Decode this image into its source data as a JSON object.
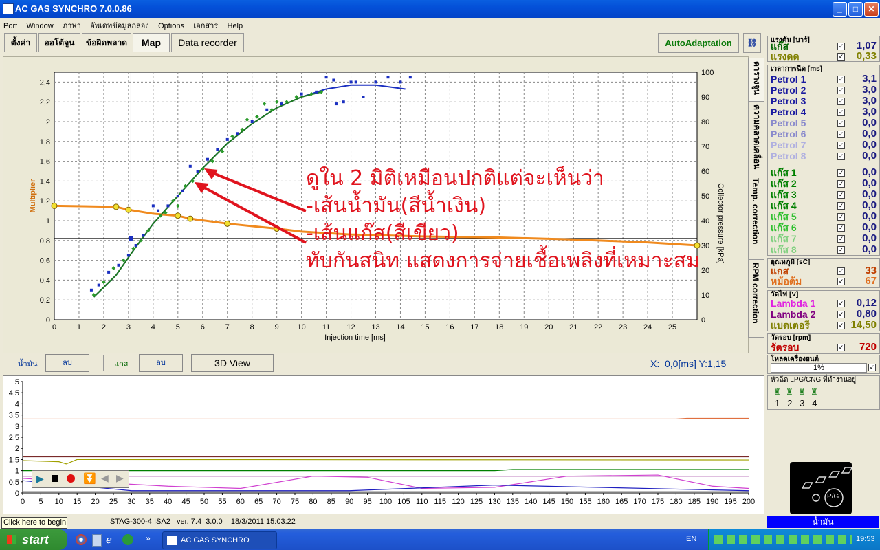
{
  "window": {
    "title": "AC GAS SYNCHRO  7.0.0.86"
  },
  "menu": [
    "Port",
    "Window",
    "ภาษา",
    "อัพเดทข้อมูลกล่อง",
    "Options",
    "เอกสาร",
    "Help"
  ],
  "tabs": [
    "ตั้งค่า",
    "ออโต้จูน",
    "ข้อผิดพลาด",
    "Map",
    "Data recorder"
  ],
  "autoadaptation": "AutoAdaptation",
  "vertical_tabs": [
    "ตารางจูน",
    "ความคลาดเคลื่อน",
    "Temp. correction",
    "RPM correction"
  ],
  "chart_data": {
    "type": "scatter",
    "xlabel": "Injection time [ms]",
    "ylabel": "Multiplier",
    "y2label": "Collector pressure [kPa]",
    "xlim": [
      0,
      26
    ],
    "ylim": [
      0,
      2.5
    ],
    "y2lim": [
      0,
      100
    ],
    "x_ticks": [
      0,
      1,
      2,
      3,
      4,
      5,
      6,
      7,
      8,
      9,
      10,
      11,
      12,
      13,
      14,
      15,
      16,
      17,
      18,
      19,
      20,
      21,
      22,
      23,
      24,
      25
    ],
    "y_ticks": [
      "0",
      "0,2",
      "0,4",
      "0,6",
      "0,8",
      "1",
      "1,2",
      "1,4",
      "1,6",
      "1,8",
      "2",
      "2,2",
      "2,4"
    ],
    "y2_ticks": [
      "0",
      "10",
      "20",
      "30",
      "40",
      "50",
      "60",
      "70",
      "80",
      "90",
      "100"
    ],
    "grid": true,
    "cursor": {
      "x": 3.1,
      "y": 0.82
    },
    "multiplier_line": {
      "name": "orange",
      "color": "#f08a1e",
      "points": [
        [
          0,
          1.15
        ],
        [
          2.5,
          1.14
        ],
        [
          3,
          1.11
        ],
        [
          4,
          1.07
        ],
        [
          5,
          1.05
        ],
        [
          5.5,
          1.02
        ],
        [
          7,
          0.97
        ],
        [
          9,
          0.92
        ],
        [
          10,
          0.89
        ],
        [
          12,
          0.86
        ],
        [
          15,
          0.84
        ],
        [
          18,
          0.83
        ],
        [
          21,
          0.81
        ],
        [
          24,
          0.78
        ],
        [
          26,
          0.75
        ]
      ],
      "markers": [
        [
          0,
          1.15
        ],
        [
          2.5,
          1.14
        ],
        [
          3,
          1.11
        ],
        [
          5,
          1.05
        ],
        [
          5.5,
          1.02
        ],
        [
          7,
          0.97
        ],
        [
          9,
          0.92
        ],
        [
          26,
          0.75
        ]
      ]
    },
    "petrol_curve": {
      "color": "#1a2fc0",
      "points": [
        [
          1.6,
          0.23
        ],
        [
          2.5,
          0.45
        ],
        [
          3.2,
          0.7
        ],
        [
          4,
          0.97
        ],
        [
          5,
          1.25
        ],
        [
          6,
          1.53
        ],
        [
          7,
          1.78
        ],
        [
          8,
          1.98
        ],
        [
          9,
          2.14
        ],
        [
          10,
          2.25
        ],
        [
          11,
          2.33
        ],
        [
          12,
          2.37
        ],
        [
          13,
          2.37
        ],
        [
          14.2,
          2.33
        ]
      ]
    },
    "gas_curve": {
      "color": "#1e7a1e",
      "points": [
        [
          1.6,
          0.23
        ],
        [
          2.5,
          0.45
        ],
        [
          3.2,
          0.7
        ],
        [
          4,
          0.97
        ],
        [
          5,
          1.25
        ],
        [
          6,
          1.53
        ],
        [
          7,
          1.78
        ],
        [
          8,
          1.98
        ],
        [
          9,
          2.14
        ],
        [
          10,
          2.25
        ],
        [
          10.8,
          2.3
        ]
      ]
    },
    "petrol_points": [
      [
        1.5,
        0.3
      ],
      [
        1.8,
        0.35
      ],
      [
        2.2,
        0.48
      ],
      [
        2.6,
        0.55
      ],
      [
        3,
        0.65
      ],
      [
        3.3,
        0.75
      ],
      [
        3.6,
        0.85
      ],
      [
        4,
        1.15
      ],
      [
        4.2,
        1.1
      ],
      [
        4.6,
        1.15
      ],
      [
        5,
        1.25
      ],
      [
        5.2,
        1.3
      ],
      [
        5.5,
        1.55
      ],
      [
        5.8,
        1.5
      ],
      [
        6.2,
        1.62
      ],
      [
        6.6,
        1.72
      ],
      [
        7,
        1.82
      ],
      [
        7.4,
        1.88
      ],
      [
        8,
        2.0
      ],
      [
        8.6,
        2.12
      ],
      [
        9.2,
        2.18
      ],
      [
        10,
        2.28
      ],
      [
        10.6,
        2.3
      ],
      [
        11,
        2.45
      ],
      [
        11.3,
        2.42
      ],
      [
        11.7,
        2.2
      ],
      [
        12,
        2.4
      ],
      [
        12.5,
        2.25
      ],
      [
        13,
        2.4
      ],
      [
        13.5,
        2.45
      ],
      [
        14,
        2.4
      ],
      [
        14.4,
        2.45
      ],
      [
        11.4,
        2.18
      ],
      [
        12.2,
        2.4
      ]
    ],
    "gas_points": [
      [
        1.6,
        0.25
      ],
      [
        2,
        0.38
      ],
      [
        2.4,
        0.52
      ],
      [
        2.8,
        0.6
      ],
      [
        3.2,
        0.72
      ],
      [
        3.5,
        0.8
      ],
      [
        3.8,
        0.9
      ],
      [
        4.3,
        1.05
      ],
      [
        4.8,
        1.2
      ],
      [
        5.3,
        1.35
      ],
      [
        5.6,
        1.4
      ],
      [
        6,
        1.52
      ],
      [
        6.4,
        1.6
      ],
      [
        6.8,
        1.7
      ],
      [
        7.2,
        1.85
      ],
      [
        7.6,
        1.92
      ],
      [
        8.2,
        2.05
      ],
      [
        8.8,
        2.12
      ],
      [
        9.4,
        2.2
      ],
      [
        9.8,
        2.25
      ],
      [
        10.4,
        2.28
      ],
      [
        10.8,
        2.3
      ],
      [
        7.8,
        2.02
      ],
      [
        8.5,
        2.18
      ],
      [
        9,
        2.2
      ],
      [
        5.0,
        1.15
      ],
      [
        4.5,
        1.08
      ]
    ]
  },
  "annotation": {
    "lines": [
      "ดูใน 2 มิติเหมือนปกติแต่จะเห็นว่า",
      "-เส้นน้ำมัน(สีน้ำเงิน)",
      "-เส้นแก๊ส(สีเขียว)",
      "ทับกันสนิท แสดงการจ่ายเชื้อเพลิงที่เหมาะสม"
    ],
    "color": "#e0141e"
  },
  "controls": {
    "petrol_label": "น้ำมัน",
    "delete_label": "ลบ",
    "gas_label": "แกส",
    "view3d": "3D View",
    "coords": "X:  0,0[ms] Y:1,15"
  },
  "osc": {
    "y_ticks": [
      "0",
      "0,5",
      "1",
      "1,5",
      "2",
      "2,5",
      "3",
      "3,5",
      "4",
      "4,5",
      "5"
    ],
    "x_ticks": [
      "0",
      "5",
      "10",
      "15",
      "20",
      "25",
      "30",
      "35",
      "40",
      "45",
      "50",
      "55",
      "60",
      "65",
      "70",
      "75",
      "80",
      "85",
      "90",
      "95",
      "100",
      "105",
      "110",
      "115",
      "120",
      "125",
      "130",
      "135",
      "140",
      "145",
      "150",
      "155",
      "160",
      "165",
      "170",
      "175",
      "180",
      "185",
      "190",
      "195",
      "200"
    ],
    "xlim": [
      0,
      200
    ],
    "ylim": [
      0,
      5
    ],
    "series": [
      {
        "color": "#e07040",
        "values": [
          [
            0,
            3.32
          ],
          [
            180,
            3.32
          ],
          [
            183,
            3.35
          ],
          [
            200,
            3.35
          ]
        ]
      },
      {
        "color": "#7a2a2a",
        "values": [
          [
            0,
            1.62
          ],
          [
            200,
            1.62
          ]
        ]
      },
      {
        "color": "#a0a000",
        "values": [
          [
            0,
            1.45
          ],
          [
            10,
            1.4
          ],
          [
            12,
            1.3
          ],
          [
            15,
            1.5
          ],
          [
            200,
            1.48
          ]
        ]
      },
      {
        "color": "#008000",
        "values": [
          [
            0,
            1.0
          ],
          [
            130,
            1.0
          ],
          [
            135,
            1.05
          ],
          [
            200,
            1.05
          ]
        ]
      },
      {
        "color": "#800080",
        "values": [
          [
            0,
            0.75
          ],
          [
            200,
            0.75
          ]
        ]
      },
      {
        "color": "#d040d0",
        "values": [
          [
            0,
            0.65
          ],
          [
            40,
            0.3
          ],
          [
            60,
            0.2
          ],
          [
            80,
            0.75
          ],
          [
            95,
            0.7
          ],
          [
            110,
            0.2
          ],
          [
            130,
            0.25
          ],
          [
            150,
            0.75
          ],
          [
            175,
            0.8
          ],
          [
            190,
            0.3
          ],
          [
            200,
            0.2
          ]
        ]
      },
      {
        "color": "#2020c0",
        "values": [
          [
            0,
            0.55
          ],
          [
            30,
            0.1
          ],
          [
            90,
            0.1
          ],
          [
            130,
            0.35
          ],
          [
            200,
            0.1
          ]
        ]
      },
      {
        "color": "#000000",
        "values": [
          [
            0,
            0.05
          ],
          [
            200,
            0.05
          ]
        ]
      }
    ]
  },
  "status": {
    "hint": "Click here to begin",
    "info": "STAG-300-4 ISA2   ver. 7.4  3.0.0    18/3/2011 15:03:22"
  },
  "side": {
    "pressure": {
      "title": "แรงดัน [บาร์]",
      "rows": [
        {
          "label": "แก๊ส",
          "value": "1,07",
          "color": "#006400"
        },
        {
          "label": "แรงดด",
          "value": "0,33",
          "color": "#808000"
        }
      ]
    },
    "injection": {
      "title": "เวลาการฉีด [ms]",
      "rows": [
        {
          "label": "Petrol 1",
          "value": "3,1",
          "color": "#1a1aa0"
        },
        {
          "label": "Petrol 2",
          "value": "3,0",
          "color": "#1a1aa0"
        },
        {
          "label": "Petrol 3",
          "value": "3,0",
          "color": "#1a1aa0"
        },
        {
          "label": "Petrol 4",
          "value": "3,0",
          "color": "#1a1aa0"
        },
        {
          "label": "Petrol 5",
          "value": "0,0",
          "color": "#8a8acc"
        },
        {
          "label": "Petrol 6",
          "value": "0,0",
          "color": "#8a8acc"
        },
        {
          "label": "Petrol 7",
          "value": "0,0",
          "color": "#b0b0e0"
        },
        {
          "label": "Petrol 8",
          "value": "0,0",
          "color": "#b0b0e0"
        },
        {
          "label": "แก๊ส 1",
          "value": "0,0",
          "color": "#008000"
        },
        {
          "label": "แก๊ส 2",
          "value": "0,0",
          "color": "#008000"
        },
        {
          "label": "แก๊ส 3",
          "value": "0,0",
          "color": "#008000"
        },
        {
          "label": "แก๊ส 4",
          "value": "0,0",
          "color": "#008000"
        },
        {
          "label": "แก๊ส 5",
          "value": "0,0",
          "color": "#30c030"
        },
        {
          "label": "แก๊ส 6",
          "value": "0,0",
          "color": "#30c030"
        },
        {
          "label": "แก๊ส 7",
          "value": "0,0",
          "color": "#80d080"
        },
        {
          "label": "แก๊ส 8",
          "value": "0,0",
          "color": "#80d080"
        }
      ]
    },
    "temp": {
      "title": "อุณหภูมิ [sC]",
      "rows": [
        {
          "label": "แกส",
          "value": "33",
          "color": "#c04000"
        },
        {
          "label": "หม้อต้ม",
          "value": "67",
          "color": "#e07020"
        }
      ]
    },
    "volt": {
      "title": "วัดไฟ [V]",
      "rows": [
        {
          "label": "Lambda 1",
          "value": "0,12",
          "color": "#e020e0"
        },
        {
          "label": "Lambda 2",
          "value": "0,80",
          "color": "#800080"
        },
        {
          "label": "แบตเตอรี",
          "value": "14,50",
          "color": "#808000"
        }
      ]
    },
    "rpm": {
      "title": "วัดรอบ [rpm]",
      "rows": [
        {
          "label": "รัตรอบ",
          "value": "720",
          "color": "#c00000"
        }
      ]
    },
    "load": {
      "title": "โหลดเครื่องยนต์",
      "value": "1%"
    },
    "injectors": {
      "title": "หัวฉีด LPG/CNG ที่ทำงานอยู่",
      "numbers": [
        "1",
        "2",
        "3",
        "4"
      ]
    },
    "fuel_mode": "น้ำมัน",
    "switch_label": "P/G"
  },
  "taskbar": {
    "start": "start",
    "task": "AC GAS SYNCHRO",
    "lang": "EN",
    "clock": "19:53"
  }
}
